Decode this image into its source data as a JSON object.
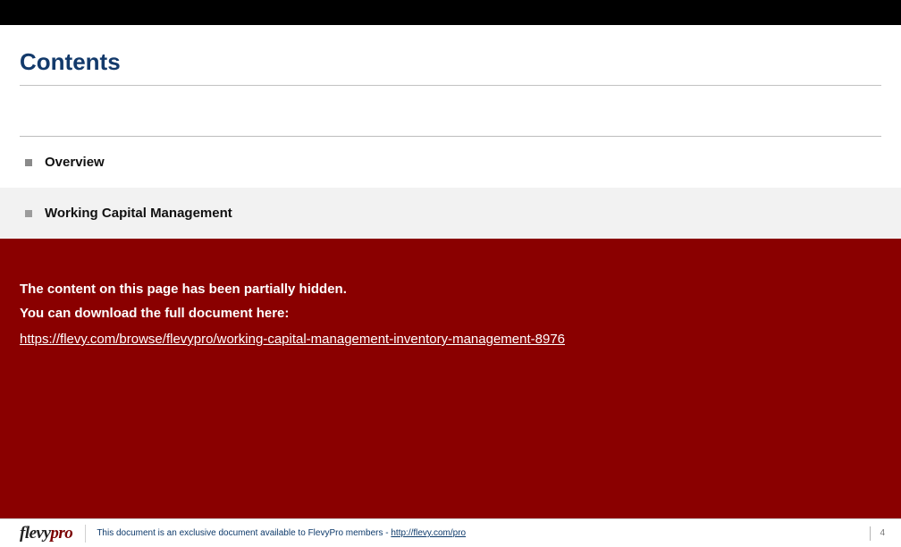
{
  "title": "Contents",
  "toc": {
    "items": [
      {
        "label": "Overview",
        "shaded": false
      },
      {
        "label": "Working Capital Management",
        "shaded": true
      }
    ]
  },
  "hidden_notice": {
    "line1": "The content on this page has been partially hidden.",
    "line2": "You can download the full document here:",
    "url": "https://flevy.com/browse/flevypro/working-capital-management-inventory-management-8976"
  },
  "footer": {
    "logo_part1": "flevy",
    "logo_part2": "pro",
    "text_prefix": "This document is an exclusive document available to ",
    "text_brand": "FlevyPro",
    "text_suffix": " members - ",
    "link_text": "http://flevy.com/pro",
    "page_number": "4"
  }
}
